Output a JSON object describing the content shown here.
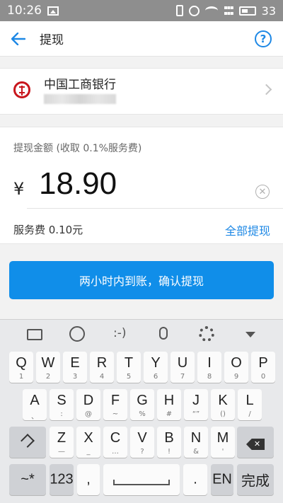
{
  "status": {
    "time": "10:26",
    "battery": "33"
  },
  "header": {
    "title": "提现",
    "help": "?"
  },
  "bank": {
    "name": "中国工商银行"
  },
  "amount": {
    "label": "提现金额 (收取 0.1%服务费)",
    "currency": "¥",
    "value": "18.90",
    "fee": "服务费 0.10元",
    "all_link": "全部提现"
  },
  "confirm_label": "两小时内到账，确认提现",
  "keyboard": {
    "toolbar": {
      "emoticon": ":-)"
    },
    "row1": [
      {
        "k": "Q",
        "s": "1"
      },
      {
        "k": "W",
        "s": "2"
      },
      {
        "k": "E",
        "s": "3"
      },
      {
        "k": "R",
        "s": "4"
      },
      {
        "k": "T",
        "s": "5"
      },
      {
        "k": "Y",
        "s": "6"
      },
      {
        "k": "U",
        "s": "7"
      },
      {
        "k": "I",
        "s": "8"
      },
      {
        "k": "O",
        "s": "9"
      },
      {
        "k": "P",
        "s": "0"
      }
    ],
    "row2": [
      {
        "k": "A",
        "s": "、"
      },
      {
        "k": "S",
        "s": ":"
      },
      {
        "k": "D",
        "s": "@"
      },
      {
        "k": "F",
        "s": "~"
      },
      {
        "k": "G",
        "s": "%"
      },
      {
        "k": "H",
        "s": "#"
      },
      {
        "k": "J",
        "s": "“”"
      },
      {
        "k": "K",
        "s": "()"
      },
      {
        "k": "L",
        "s": "/"
      }
    ],
    "row3": [
      {
        "k": "Z",
        "s": "—"
      },
      {
        "k": "X",
        "s": "_"
      },
      {
        "k": "C",
        "s": "…"
      },
      {
        "k": "V",
        "s": "?"
      },
      {
        "k": "B",
        "s": "!"
      },
      {
        "k": "N",
        "s": "&"
      },
      {
        "k": "M",
        "s": "'"
      }
    ],
    "symbols": "~*",
    "numbers": "123",
    "comma": ",",
    "period": ".",
    "lang": "EN",
    "done": "完成",
    "delete_mark": "✕"
  }
}
